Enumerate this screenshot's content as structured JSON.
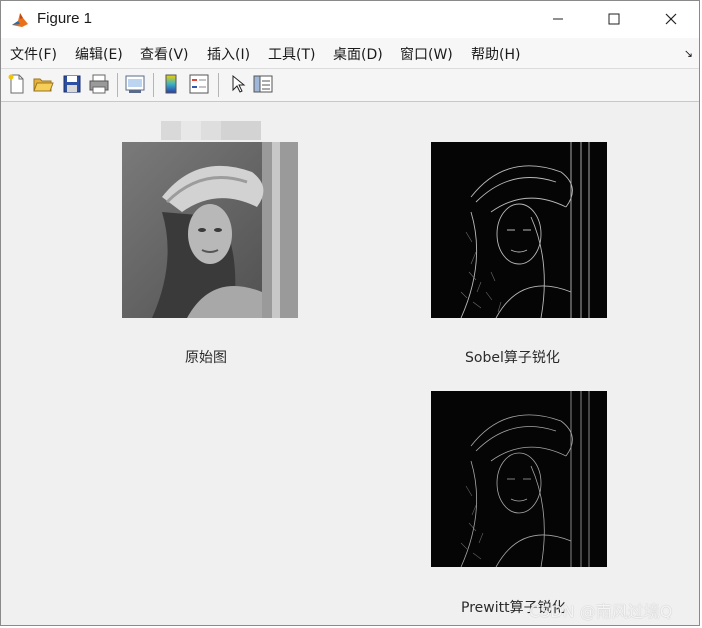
{
  "window": {
    "title": "Figure 1"
  },
  "menu": [
    {
      "label": "文件(F)"
    },
    {
      "label": "编辑(E)"
    },
    {
      "label": "查看(V)"
    },
    {
      "label": "插入(I)"
    },
    {
      "label": "工具(T)"
    },
    {
      "label": "桌面(D)"
    },
    {
      "label": "窗口(W)"
    },
    {
      "label": "帮助(H)"
    }
  ],
  "toolbar": {
    "icons": [
      "new-figure-icon",
      "open-folder-icon",
      "save-icon",
      "print-icon",
      "link-plot-icon",
      "colorbar-icon",
      "legend-icon",
      "pointer-icon",
      "property-editor-icon"
    ]
  },
  "subplots": [
    {
      "caption": "原始图",
      "image": "grayscale portrait photo"
    },
    {
      "caption": "Sobel算子锐化",
      "image": "edge-detected portrait"
    },
    {
      "caption": "Prewitt算子锐化",
      "image": "edge-detected portrait"
    }
  ],
  "watermark": "CSDN @南风过境Q",
  "colors": {
    "background": "#f0f0f0",
    "titlebar": "#ffffff",
    "menubar": "#f7f7f7"
  }
}
